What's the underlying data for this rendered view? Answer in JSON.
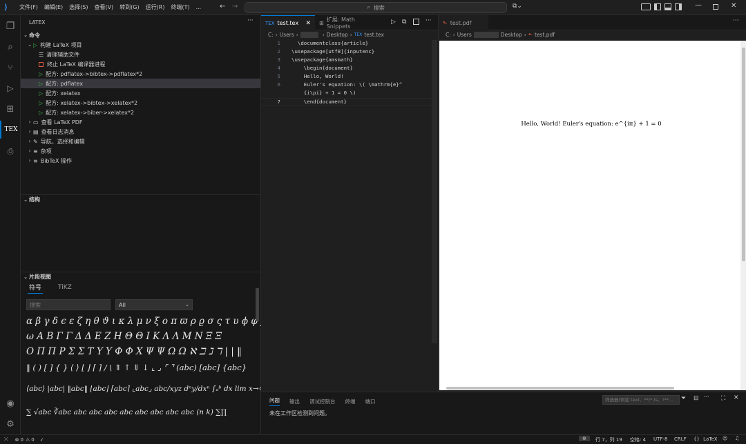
{
  "titlebar": {
    "menu": [
      "文件(F)",
      "编辑(E)",
      "选择(S)",
      "查看(V)",
      "转到(G)",
      "运行(R)",
      "终端(T)",
      "..."
    ],
    "search": "搜索"
  },
  "sidebar": {
    "title": "LATEX",
    "commands_header": "命令",
    "items": [
      {
        "label": "构建 LaTeX 项目",
        "icon": "play-icon",
        "chev": "⌄"
      },
      {
        "label": "清理辅助文件",
        "icon": "clean-icon"
      },
      {
        "label": "终止 LaTeX 编译器进程",
        "icon": "stop-icon"
      },
      {
        "label": "配方: pdflatex->bibtex->pdflatex*2",
        "icon": "play-icon"
      },
      {
        "label": "配方: pdflatex",
        "icon": "play-icon"
      },
      {
        "label": "配方: xelatex",
        "icon": "play-icon"
      },
      {
        "label": "配方: xelatex->bibtex->xelatex*2",
        "icon": "play-icon"
      },
      {
        "label": "配方: xelatex->biber->xelatex*2",
        "icon": "play-icon"
      },
      {
        "label": "查看 LaTeX PDF",
        "icon": "view-icon",
        "chev": "›"
      },
      {
        "label": "查看日志消息",
        "icon": "log-icon",
        "chev": "›"
      },
      {
        "label": "导航、选择和编辑",
        "icon": "edit-icon",
        "chev": "›"
      },
      {
        "label": "杂项",
        "icon": "list-icon",
        "chev": "›"
      },
      {
        "label": "BibTeX 操作",
        "icon": "list-icon",
        "chev": "›"
      }
    ],
    "structure_header": "结构",
    "snippet_header": "片段视图",
    "snippet_tabs": [
      "符号",
      "TiKZ"
    ],
    "snippet_search_placeholder": "搜索",
    "snippet_filter": "All",
    "symbol_rows": [
      "α β γ δ ϵ ε ζ η θ ϑ ι κ λ μ ν ξ ο π ϖ ρ ϱ σ ς τ υ ϕ φ χ ψ",
      "ω A B Γ Γ Δ Δ E Z H Θ Θ I K Λ Λ M N Ξ Ξ",
      "O Π Π P Σ Σ T Υ Υ Φ Φ X Ψ Ψ Ω Ω ℵ ℶ ℷ ℸ | | ‖",
      "‖ ( ) [ ] { } ⟨ ⟩ ⌊ ⌋ ⌈ ⌉ / \\ ⇑ ↑ ⇓ ↓ ⌞ ⌟ ⌜ ⌝ (abc) [abc] {abc}",
      "⟨abc⟩ |abc| ‖abc‖ ⌊abc⌋ ⌈abc⌉ ⌞abc⌟ abc/xyz dⁿy/dxⁿ ∫ₐᵇ dx lim x→∞",
      "∑ √abc ∛abc abc abc abc abc abc abc abc abc (n k) ∑∏"
    ]
  },
  "editor": {
    "tabs": [
      {
        "label": "test.tex",
        "active": true
      },
      {
        "label": "扩展: Math Snippets",
        "active": false
      }
    ],
    "breadcrumb": [
      "C:",
      "Users",
      "Desktop",
      "test.tex"
    ],
    "lines": [
      {
        "n": "1",
        "code": "  \\documentclass{article}"
      },
      {
        "n": "2",
        "code": "\\usepackage[utf8]{inputenc}"
      },
      {
        "n": "3",
        "code": "\\usepackage{amsmath}"
      },
      {
        "n": "4",
        "code": "    \\begin{document}"
      },
      {
        "n": "5",
        "code": "    Hello, World!"
      },
      {
        "n": "6",
        "code": "    Euler's equation: \\( \\mathrm{e}^"
      },
      {
        "n": "",
        "code": "    {i\\pi} + 1 = 0 \\)"
      },
      {
        "n": "7",
        "code": "    \\end{document}"
      }
    ]
  },
  "pdf": {
    "tab": "test.pdf",
    "breadcrumb": [
      "C:",
      "Users",
      "Desktop",
      "test.pdf"
    ],
    "content": "Hello, World! Euler's equation: e^{iπ} + 1 = 0"
  },
  "panel": {
    "tabs": [
      "问题",
      "输出",
      "调试控制台",
      "终端",
      "端口"
    ],
    "filter_placeholder": "筛选器(例如 text、**/*.ts、!**...",
    "message": "未在工作区检测到问题。"
  },
  "statusbar": {
    "errors": "0",
    "warnings": "0",
    "position": "行 7，列 19",
    "spaces": "空格: 4",
    "encoding": "UTF-8",
    "eol": "CRLF",
    "language": "LaTeX"
  },
  "colors": {
    "accent": "#0078d4",
    "play": "#3fb950",
    "stop": "#e05d44"
  }
}
